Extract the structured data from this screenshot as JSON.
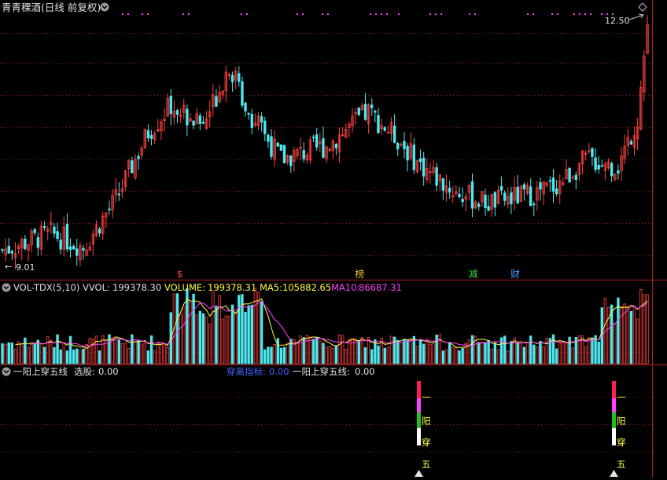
{
  "window": {
    "title": "青青稞酒(日线 前复权)",
    "menu_icon": "chevron-down-icon",
    "corner_icon": "diamond-icon"
  },
  "price_panel": {
    "high_label": "12.50",
    "low_label": "9.01",
    "markers": [
      {
        "text": "$",
        "color": "#ff4040",
        "bar": 55
      },
      {
        "text": "榜",
        "color": "#f0c040",
        "bar": 110
      },
      {
        "text": "减",
        "color": "#40d040",
        "bar": 145
      },
      {
        "text": "财",
        "color": "#40a0ff",
        "bar": 158
      }
    ]
  },
  "volume_panel": {
    "indicator": "VOL-TDX(5,10)",
    "vvol_label": "VVOL:",
    "vvol_value": "199378.30",
    "volume_label": "VOLUME:",
    "volume_value": "199378.31",
    "ma5_label": "MA5:",
    "ma5_value": "105882.65",
    "ma10_label": "MA10:",
    "ma10_value": "86687.31"
  },
  "signal_panel": {
    "name": "一阳上穿五线",
    "select_label": "选股:",
    "select_value": "0.00",
    "cross_label": "穿离指标:",
    "cross_value": "0.00",
    "line_label": "一阳上穿五线:",
    "line_value": "0.00",
    "column_chars": [
      "一",
      "阳",
      "穿",
      "五"
    ]
  },
  "colors": {
    "up": "#ff4040",
    "down": "#4fe8ee",
    "grid": "#8b1a1a",
    "divider": "#b02020",
    "title": "#e0e0e0",
    "ma5": "#ffff40",
    "ma10": "#ff40ff",
    "cross_label": "#4060ff"
  }
}
